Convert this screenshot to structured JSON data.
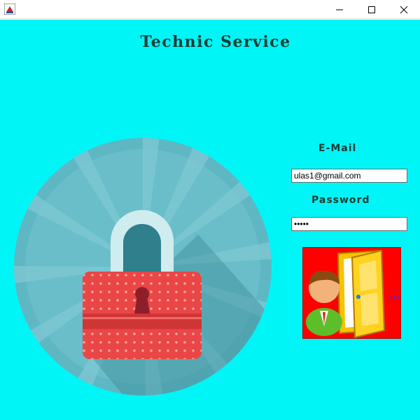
{
  "window": {
    "title": "",
    "controls": {
      "minimize": "minimize-icon",
      "maximize": "maximize-icon",
      "close": "close-icon"
    }
  },
  "app": {
    "title": "Technic Service"
  },
  "colors": {
    "background": "#00f5f7",
    "text": "#1d3b33",
    "button": "#ff0000",
    "lock": "#ea4646"
  },
  "form": {
    "email_label": "E-Mail",
    "email_value": "ulas1@gmail.com",
    "password_label": "Password",
    "password_value": "•••••"
  },
  "login_button": {
    "icon": "user-door-login-icon"
  }
}
